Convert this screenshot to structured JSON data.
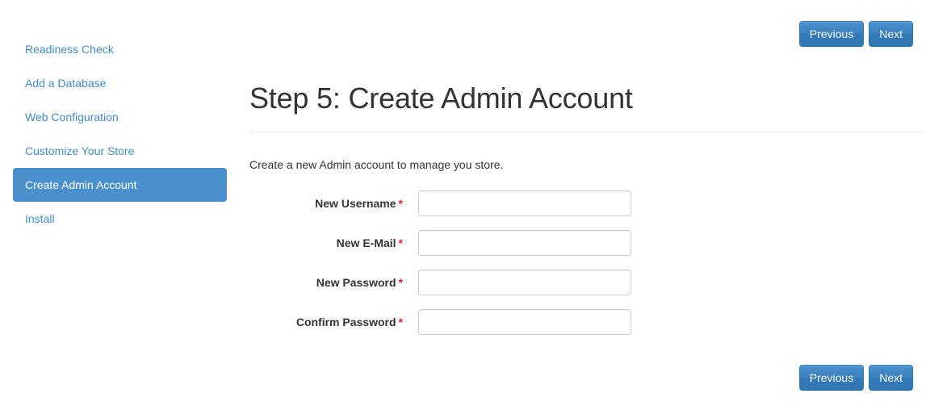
{
  "sidebar": {
    "items": [
      {
        "label": "Readiness Check",
        "name": "sidebar-item-readiness-check",
        "active": false
      },
      {
        "label": "Add a Database",
        "name": "sidebar-item-add-a-database",
        "active": false
      },
      {
        "label": "Web Configuration",
        "name": "sidebar-item-web-configuration",
        "active": false
      },
      {
        "label": "Customize Your Store",
        "name": "sidebar-item-customize-your-store",
        "active": false
      },
      {
        "label": "Create Admin Account",
        "name": "sidebar-item-create-admin-account",
        "active": true
      },
      {
        "label": "Install",
        "name": "sidebar-item-install",
        "active": false
      }
    ]
  },
  "nav_buttons": {
    "previous_label": "Previous",
    "next_label": "Next"
  },
  "main": {
    "title": "Step 5: Create Admin Account",
    "description": "Create a new Admin account to manage you store.",
    "required_marker": "*",
    "fields": [
      {
        "label": "New Username",
        "value": "",
        "placeholder": "",
        "required": true,
        "name": "new-username-input",
        "type": "text"
      },
      {
        "label": "New E-Mail",
        "value": "",
        "placeholder": "",
        "required": true,
        "name": "new-email-input",
        "type": "text"
      },
      {
        "label": "New Password",
        "value": "",
        "placeholder": "",
        "required": true,
        "name": "new-password-input",
        "type": "password"
      },
      {
        "label": "Confirm Password",
        "value": "",
        "placeholder": "",
        "required": true,
        "name": "confirm-password-input",
        "type": "password"
      }
    ]
  },
  "colors": {
    "accent": "#428bca",
    "active_nav_bg": "#4a90cd",
    "button_bg": "#3a80c0",
    "required_red": "#e8262a",
    "rule": "#eeeeee",
    "input_border": "#cccccc"
  }
}
